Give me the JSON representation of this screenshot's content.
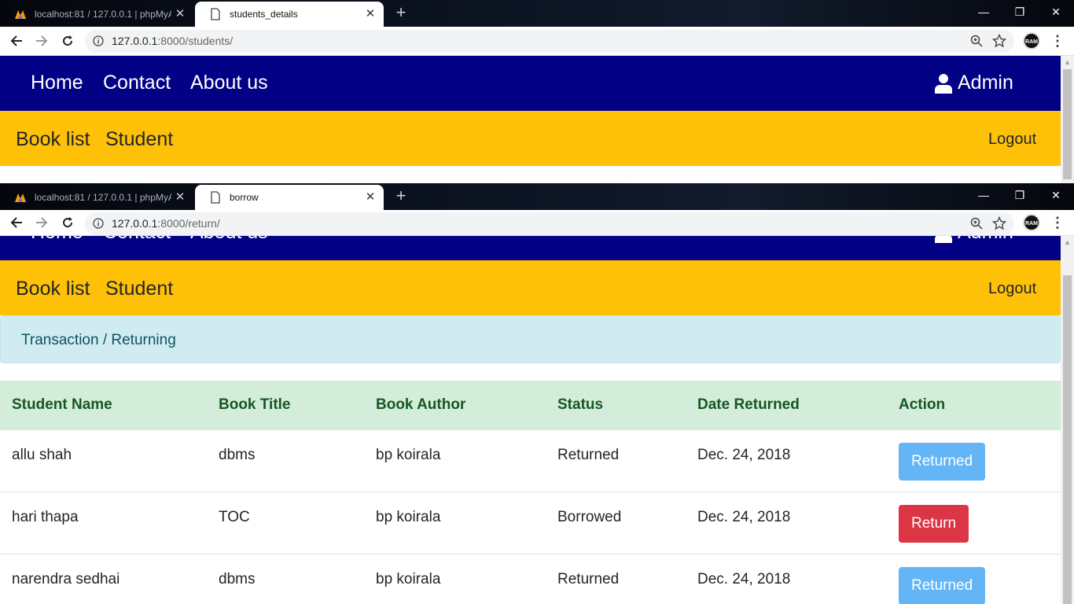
{
  "windows": [
    {
      "tabs": [
        {
          "title": "localhost:81 / 127.0.0.1 | phpMyA",
          "active": false
        },
        {
          "title": "students_details",
          "active": true
        }
      ],
      "url": {
        "host": "127.0.0.1",
        "rest": ":8000/students/"
      },
      "avatar_text": "RAM"
    },
    {
      "tabs": [
        {
          "title": "localhost:81 / 127.0.0.1 | phpMyA",
          "active": false
        },
        {
          "title": "borrow",
          "active": true
        }
      ],
      "url": {
        "host": "127.0.0.1",
        "rest": ":8000/return/"
      },
      "avatar_text": "RAM"
    }
  ],
  "nav": {
    "primary": [
      "Home",
      "Contact",
      "About us"
    ],
    "admin_label": "Admin",
    "secondary": [
      "Book list",
      "Student"
    ],
    "logout_label": "Logout"
  },
  "breadcrumb": "Transaction / Returning",
  "table": {
    "headers": [
      "Student Name",
      "Book Title",
      "Book Author",
      "Status",
      "Date Returned",
      "Action"
    ],
    "rows": [
      {
        "student": "allu shah",
        "title": "dbms",
        "author": "bp koirala",
        "status": "Returned",
        "date": "Dec. 24, 2018",
        "action": "Returned",
        "action_kind": "returned"
      },
      {
        "student": "hari thapa",
        "title": "TOC",
        "author": "bp koirala",
        "status": "Borrowed",
        "date": "Dec. 24, 2018",
        "action": "Return",
        "action_kind": "return"
      },
      {
        "student": "narendra sedhai",
        "title": "dbms",
        "author": "bp koirala",
        "status": "Returned",
        "date": "Dec. 24, 2018",
        "action": "Returned",
        "action_kind": "returned"
      }
    ]
  },
  "colors": {
    "primary_nav": "#020085",
    "secondary_nav": "#ffc107",
    "breadcrumb_bg": "#d1ecf1",
    "table_header_bg": "#d4edda",
    "returned_button": "#64b5f6",
    "return_button": "#dc3545"
  }
}
